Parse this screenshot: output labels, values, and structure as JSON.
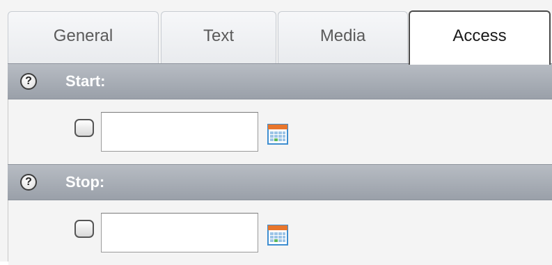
{
  "tabs": [
    {
      "label": "General",
      "active": false
    },
    {
      "label": "Text",
      "active": false
    },
    {
      "label": "Media",
      "active": false
    },
    {
      "label": "Access",
      "active": true
    }
  ],
  "sections": {
    "start": {
      "label": "Start:",
      "help_icon": "?",
      "date_value": "",
      "checked": false
    },
    "stop": {
      "label": "Stop:",
      "help_icon": "?",
      "date_value": "",
      "checked": false
    }
  },
  "icons": {
    "help": "question-mark-circle",
    "calendar": "calendar-grid"
  },
  "colors": {
    "header_bar": "#a5aab2",
    "header_text": "#ffffff",
    "calendar_accent": "#e8762c",
    "calendar_grid": "#3e8ed0",
    "calendar_cell": "#5cb85c"
  }
}
